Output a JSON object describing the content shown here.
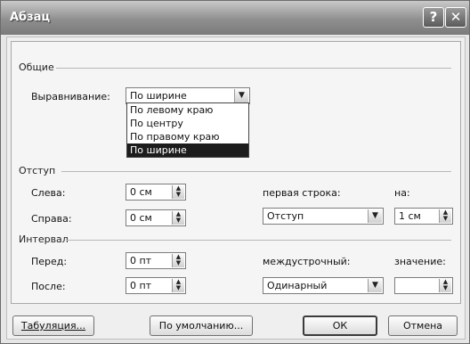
{
  "window": {
    "title": "Абзац",
    "help_btn": "?",
    "close_btn": "✕"
  },
  "general": {
    "section": "Общие",
    "alignment_label": "Выравнивание:",
    "alignment_value": "По ширине",
    "alignment_options": [
      "По левому краю",
      "По центру",
      "По правому краю",
      "По ширине"
    ]
  },
  "indent": {
    "section": "Отступ",
    "left_label": "Слева:",
    "left_value": "0 см",
    "right_label": "Справа:",
    "right_value": "0 см",
    "first_line_label": "первая строка:",
    "first_line_value": "Отступ",
    "by_label": "на:",
    "by_value": "1 см"
  },
  "spacing": {
    "section": "Интервал",
    "before_label": "Перед:",
    "before_value": "0 пт",
    "after_label": "После:",
    "after_value": "0 пт",
    "line_spacing_label": "междустрочный:",
    "line_spacing_value": "Одинарный",
    "value_label": "значение:",
    "value_value": ""
  },
  "buttons": {
    "tabs": "Табуляция...",
    "default": "По умолчанию...",
    "ok": "ОК",
    "cancel": "Отмена"
  },
  "colors": {
    "title_bar": "#8f8f8f",
    "selection": "#1c1c1c"
  }
}
